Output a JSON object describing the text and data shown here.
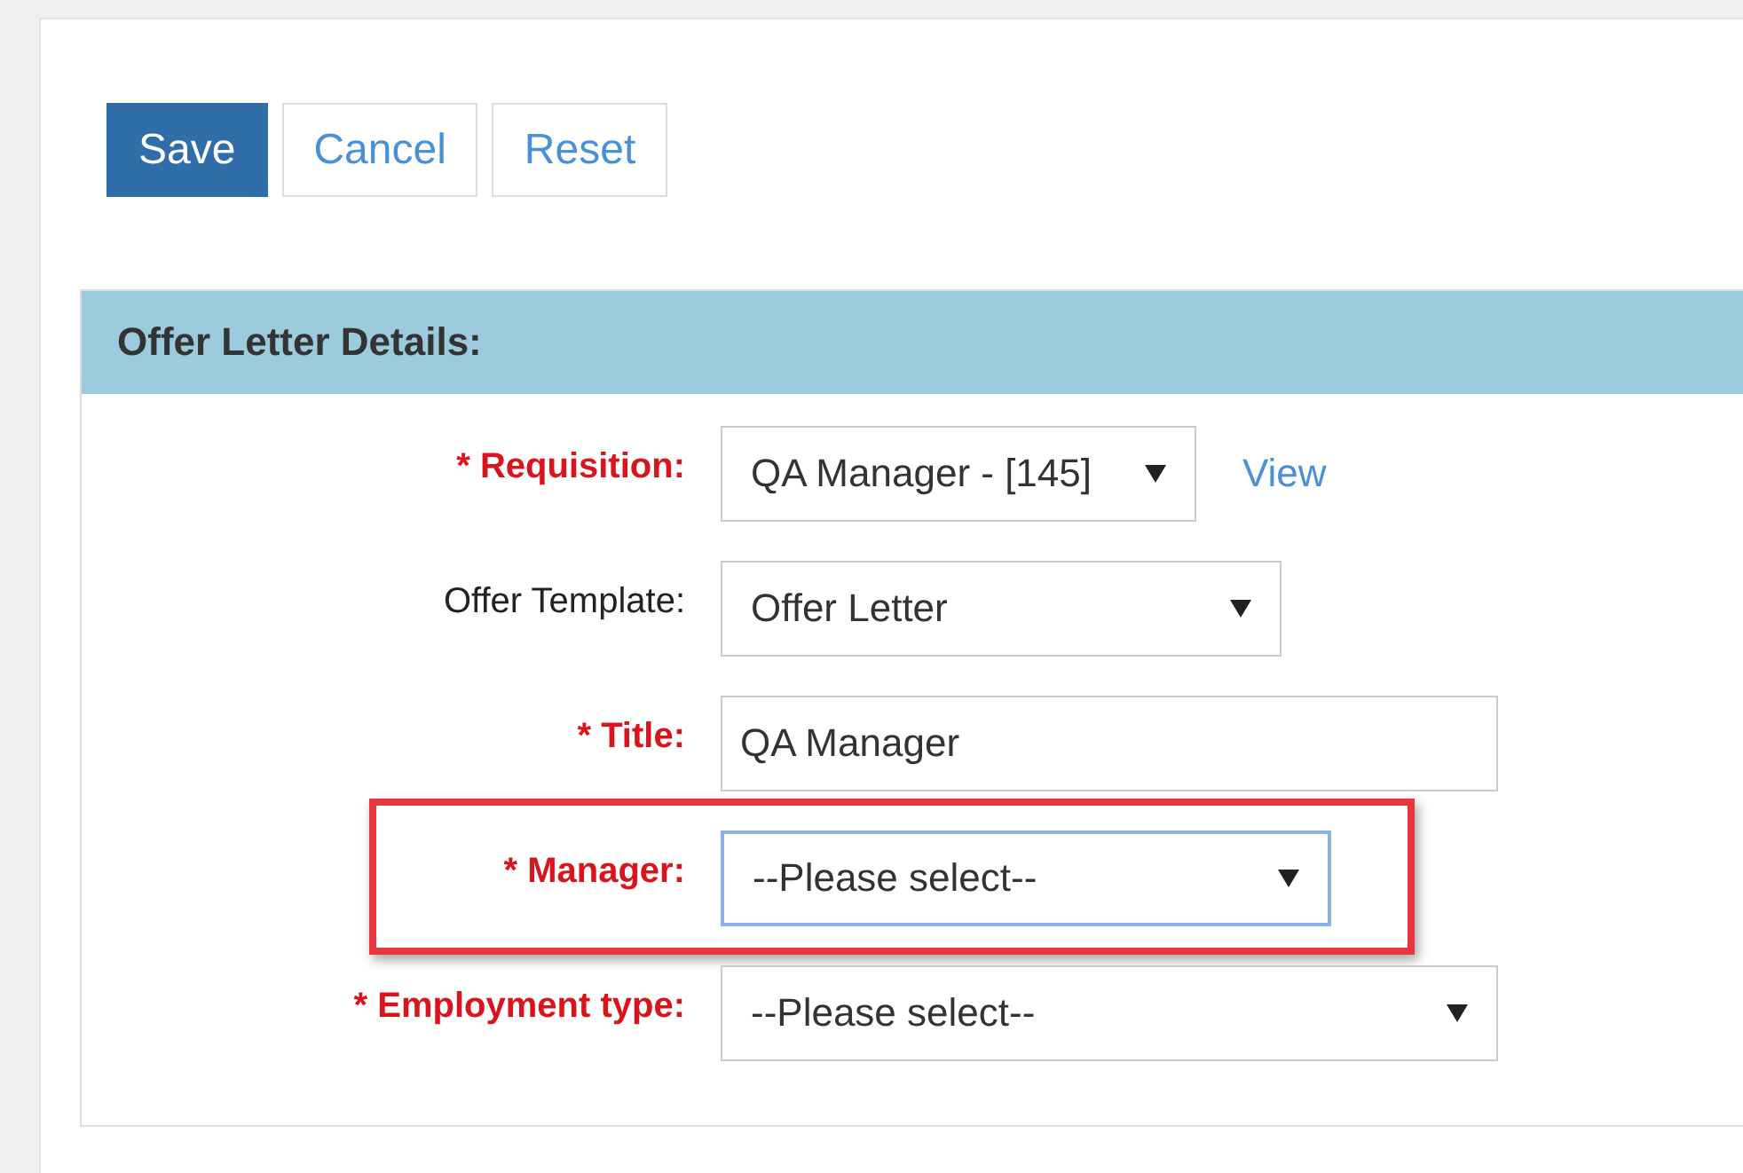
{
  "buttons": [
    {
      "label": "Save",
      "kind": "primary"
    },
    {
      "label": "Cancel",
      "kind": "secondary"
    },
    {
      "label": "Reset",
      "kind": "secondary"
    }
  ],
  "section": {
    "title": "Offer Letter Details:",
    "fields": [
      {
        "label": "* Requisition:",
        "required": true,
        "kind": "select",
        "value": "QA Manager - [145]",
        "link": "View",
        "highlighted": false
      },
      {
        "label": "Offer Template:",
        "required": false,
        "kind": "select",
        "value": "Offer Letter",
        "highlighted": false
      },
      {
        "label": "* Title:",
        "required": true,
        "kind": "text",
        "value": "QA Manager",
        "highlighted": false
      },
      {
        "label": "* Manager:",
        "required": true,
        "kind": "select",
        "value": "--Please select--",
        "highlighted": true
      },
      {
        "label": "* Employment type:",
        "required": true,
        "kind": "select",
        "value": "--Please select--",
        "highlighted": false
      }
    ]
  }
}
